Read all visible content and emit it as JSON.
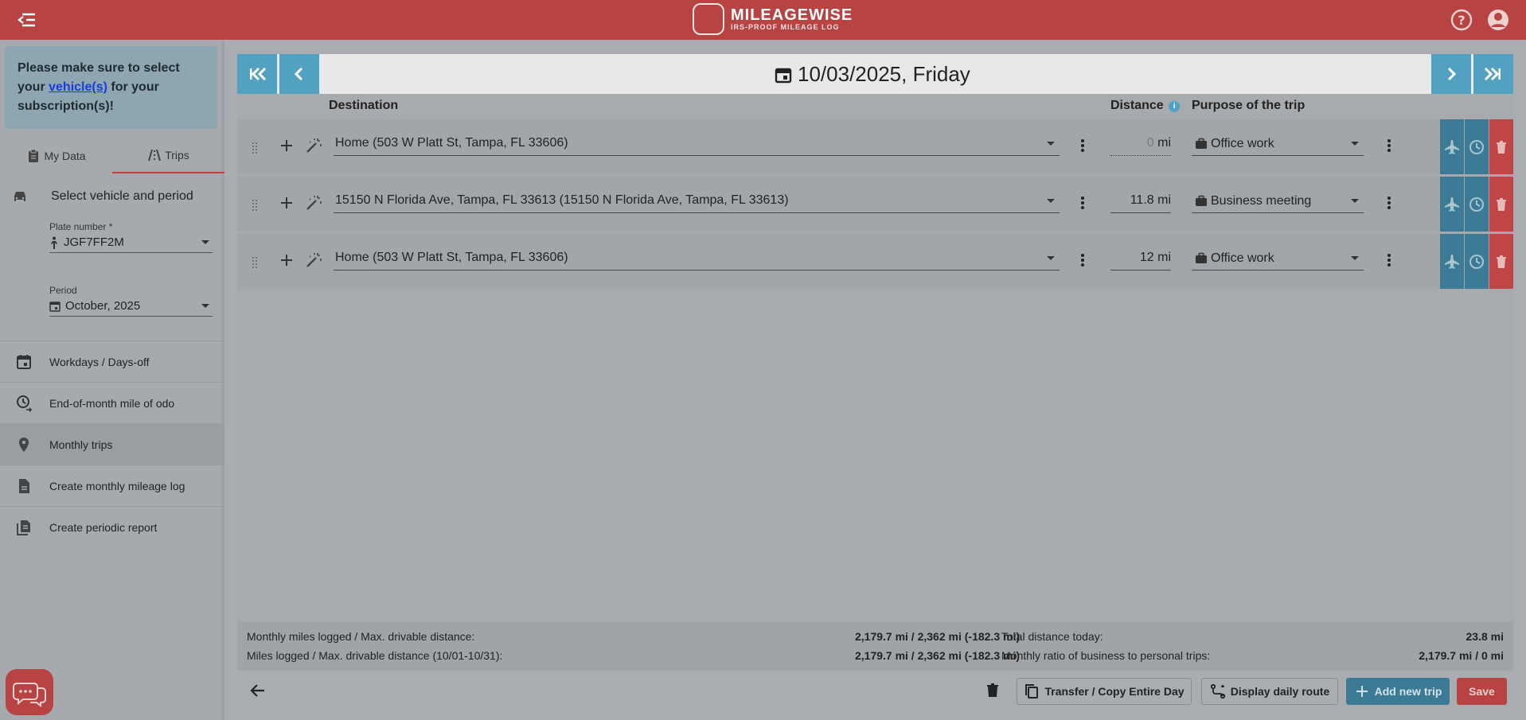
{
  "header": {
    "brand_name": "MILEAGEWISE",
    "brand_tagline": "IRS-PROOF MILEAGE LOG"
  },
  "sidebar": {
    "notice_before": "Please make sure to select your ",
    "notice_link": "vehicle(s)",
    "notice_after": " for your subscription(s)!",
    "tabs": [
      {
        "label": "My Data",
        "icon": "clipboard-icon"
      },
      {
        "label": "Trips",
        "icon": "road-icon",
        "active": true
      }
    ],
    "section_title": "Select vehicle and period",
    "plate_label": "Plate number *",
    "plate_value": "JGF7FF2M",
    "period_label": "Period",
    "period_value": "October, 2025",
    "menu": [
      {
        "label": "Workdays / Days-off",
        "icon": "calendar-icon"
      },
      {
        "label": "End-of-month mile of odo",
        "icon": "odometer-icon"
      },
      {
        "label": "Monthly trips",
        "icon": "map-pin-icon",
        "active": true
      },
      {
        "label": "Create monthly mileage log",
        "icon": "document-icon"
      },
      {
        "label": "Create periodic report",
        "icon": "report-icon"
      }
    ]
  },
  "datebar": {
    "date": "10/03/2025, Friday"
  },
  "columns": {
    "destination": "Destination",
    "distance": "Distance",
    "purpose": "Purpose of the trip"
  },
  "trips": [
    {
      "destination": "Home (503 W Platt St, Tampa, FL 33606)",
      "distance": "0",
      "unit": "mi",
      "purpose": "Office work"
    },
    {
      "destination": "15150 N Florida Ave, Tampa, FL 33613 (15150 N Florida Ave, Tampa, FL 33613)",
      "distance": "11.8",
      "unit": "mi",
      "purpose": "Business meeting"
    },
    {
      "destination": "Home (503 W Platt St, Tampa, FL 33606)",
      "distance": "12",
      "unit": "mi",
      "purpose": "Office work"
    }
  ],
  "summary": {
    "monthly_label": "Monthly miles logged / Max. drivable distance:",
    "monthly_value": "2,179.7 mi / 2,362 mi (-182.3 mi)",
    "range_label": "Miles logged / Max. drivable distance (10/01-10/31):",
    "range_value": "2,179.7 mi / 2,362 mi (-182.3 mi)",
    "today_label": "Total distance today:",
    "today_value": "23.8 mi",
    "ratio_label": "Monthly ratio of business to personal trips:",
    "ratio_value": "2,179.7 mi / 0 mi"
  },
  "toolbar": {
    "transfer": "Transfer / Copy Entire Day",
    "route": "Display daily route",
    "add": "Add new trip",
    "save": "Save"
  },
  "colors": {
    "brand_red": "#b74443",
    "accent_blue": "#52a1c1",
    "dark_blue": "#3c7a95"
  }
}
